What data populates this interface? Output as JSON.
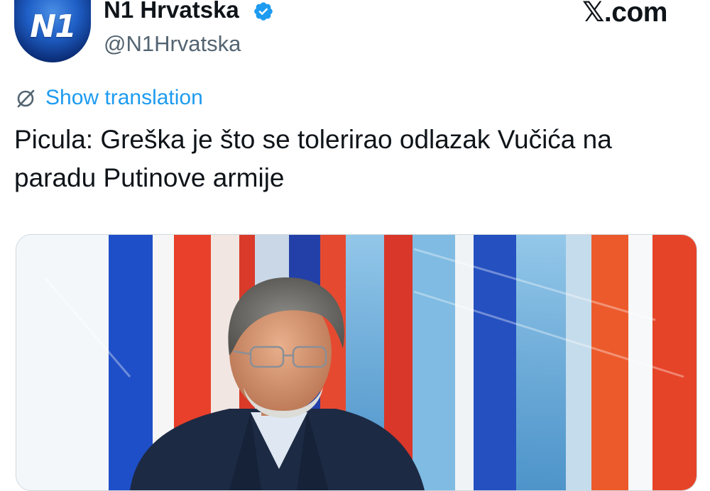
{
  "account": {
    "display_name": "N1 Hrvatska",
    "handle": "@N1Hrvatska",
    "avatar_text": "N1",
    "verified": true
  },
  "site": {
    "badge_glyph": "𝕏",
    "badge_suffix": ".com"
  },
  "tweet": {
    "translate_label": "Show translation",
    "text": "Picula: Greška je što se tolerirao odlazak Vučića na paradu Putinove armije"
  },
  "colors": {
    "link": "#1d9bf0",
    "verified_badge": "#1d9bf0",
    "text_primary": "#0f1419",
    "text_secondary": "#536471",
    "flag_red": "#e8402a",
    "flag_blue": "#1f4fc8"
  },
  "icons": {
    "verified": "verified-badge-icon",
    "translate": "globe-slash-icon"
  }
}
